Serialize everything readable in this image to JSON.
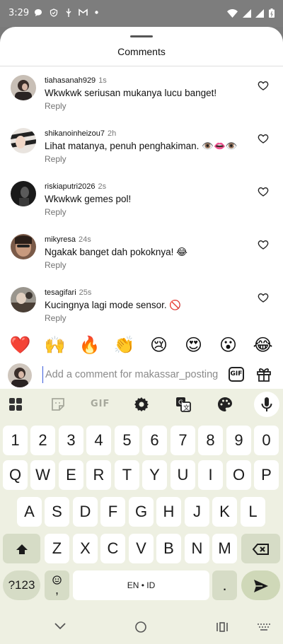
{
  "status_bar": {
    "time": "3:29",
    "left_icons": [
      "chat-bubble-icon",
      "shield-icon",
      "usb-icon",
      "gmail-icon",
      "dot-icon"
    ],
    "right_icons": [
      "wifi-icon",
      "signal-icon",
      "signal-icon",
      "battery-icon"
    ]
  },
  "sheet": {
    "title": "Comments"
  },
  "comments": [
    {
      "user": "tiahasanah929",
      "time": "1s",
      "text": "Wkwkwk seriusan mukanya lucu banget!",
      "reply": "Reply"
    },
    {
      "user": "shikanoinheizou7",
      "time": "2h",
      "text": "Lihat matanya, penuh penghakiman. 👁️👄👁️",
      "reply": "Reply"
    },
    {
      "user": "riskiaputri2026",
      "time": "2s",
      "text": "Wkwkwk gemes pol!",
      "reply": "Reply"
    },
    {
      "user": "mikyresa",
      "time": "24s",
      "text": "Ngakak banget dah pokoknya! 😂",
      "reply": "Reply"
    },
    {
      "user": "tesagifari",
      "time": "25s",
      "text": "Kucingnya lagi mode sensor. 🚫",
      "reply": "Reply"
    }
  ],
  "reactions": [
    "❤️",
    "🙌",
    "🔥",
    "👏",
    "😢",
    "😍",
    "😮",
    "😂"
  ],
  "composer": {
    "placeholder": "Add a comment for makassar_posting",
    "gif_label": "GIF"
  },
  "keyboard": {
    "toolbar_gif": "GIF",
    "row_numbers": [
      "1",
      "2",
      "3",
      "4",
      "5",
      "6",
      "7",
      "8",
      "9",
      "0"
    ],
    "row_q": [
      "Q",
      "W",
      "E",
      "R",
      "T",
      "Y",
      "U",
      "I",
      "O",
      "P"
    ],
    "row_a": [
      "A",
      "S",
      "D",
      "F",
      "G",
      "H",
      "J",
      "K",
      "L"
    ],
    "row_z": [
      "Z",
      "X",
      "C",
      "V",
      "B",
      "N",
      "M"
    ],
    "symbols_label": "?123",
    "comma_label": ",",
    "space_label": "EN • ID",
    "period_label": "."
  },
  "colors": {
    "keyboard_bg": "#eef0e2",
    "key_dark": "#d6dcc6",
    "cursor": "#3b5bdb"
  }
}
